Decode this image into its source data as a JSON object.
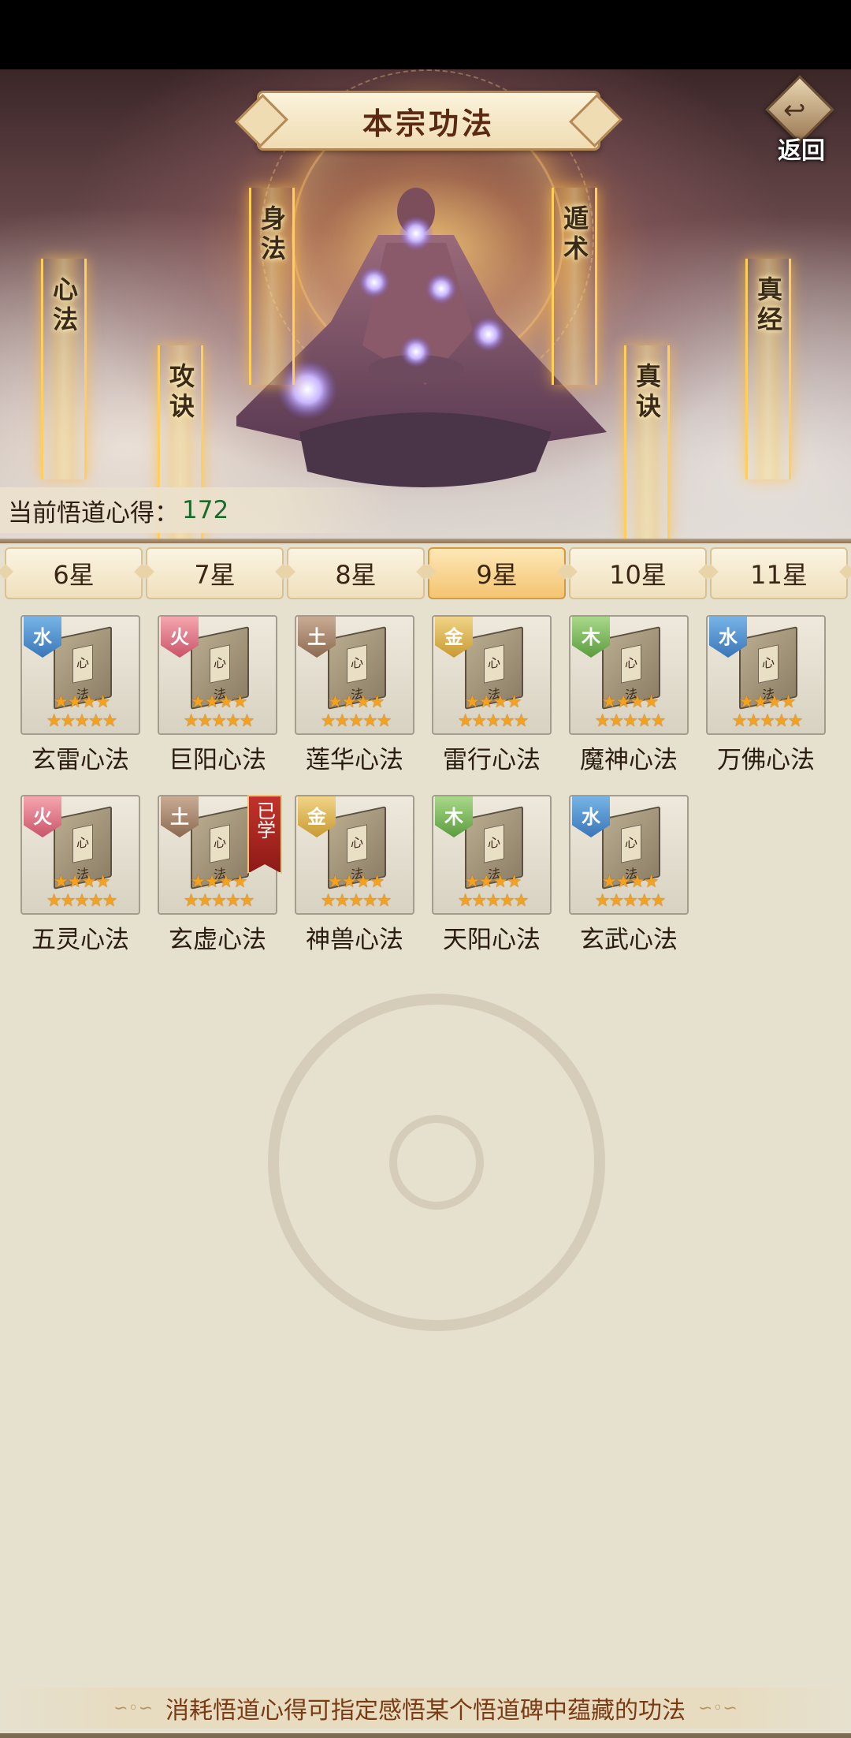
{
  "header": {
    "title": "本宗功法",
    "back_label": "返回"
  },
  "pillars": [
    {
      "label": "心法"
    },
    {
      "label": "身法"
    },
    {
      "label": "攻诀"
    },
    {
      "label": "遁术"
    },
    {
      "label": "真诀"
    },
    {
      "label": "真经"
    }
  ],
  "insight": {
    "label": "当前悟道心得：",
    "value": "172"
  },
  "tabs": [
    {
      "label": "6星",
      "active": false
    },
    {
      "label": "7星",
      "active": false
    },
    {
      "label": "8星",
      "active": false
    },
    {
      "label": "9星",
      "active": true
    },
    {
      "label": "10星",
      "active": false
    },
    {
      "label": "11星",
      "active": false
    }
  ],
  "techniques": [
    {
      "name": "玄雷心法",
      "element": "水",
      "element_color": "#3a76b8",
      "stars": 9,
      "learned": false
    },
    {
      "name": "巨阳心法",
      "element": "火",
      "element_color": "#c9546a",
      "stars": 9,
      "learned": false
    },
    {
      "name": "莲华心法",
      "element": "土",
      "element_color": "#8c6a52",
      "stars": 9,
      "learned": false
    },
    {
      "name": "雷行心法",
      "element": "金",
      "element_color": "#c89a32",
      "stars": 9,
      "learned": false
    },
    {
      "name": "魔神心法",
      "element": "木",
      "element_color": "#5b9c3e",
      "stars": 9,
      "learned": false
    },
    {
      "name": "万佛心法",
      "element": "水",
      "element_color": "#3a76b8",
      "stars": 9,
      "learned": false
    },
    {
      "name": "五灵心法",
      "element": "火",
      "element_color": "#c9546a",
      "stars": 9,
      "learned": false
    },
    {
      "name": "玄虚心法",
      "element": "土",
      "element_color": "#8c6a52",
      "stars": 9,
      "learned": true,
      "learned_label": "已学"
    },
    {
      "name": "神兽心法",
      "element": "金",
      "element_color": "#c89a32",
      "stars": 9,
      "learned": false
    },
    {
      "name": "天阳心法",
      "element": "木",
      "element_color": "#5b9c3e",
      "stars": 9,
      "learned": false
    },
    {
      "name": "玄武心法",
      "element": "水",
      "element_color": "#3a76b8",
      "stars": 9,
      "learned": false
    }
  ],
  "book_tag": "心法",
  "footer": {
    "text": "消耗悟道心得可指定感悟某个悟道碑中蕴藏的功法"
  },
  "icons": {
    "back": "back-arrow-icon",
    "book": "manual-book-icon",
    "star": "star-icon"
  }
}
